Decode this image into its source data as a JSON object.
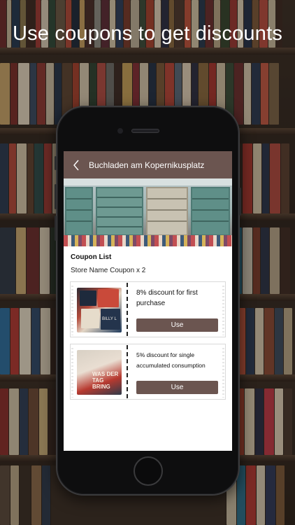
{
  "headline": "Use coupons to get discounts",
  "app": {
    "store_title": "Buchladen am Kopernikusplatz",
    "back_icon": "chevron-left-icon",
    "section_title": "Coupon List",
    "store_coupon_count": "Store Name Coupon x 2",
    "accent_color": "#6b5550",
    "coupons": [
      {
        "description": "8% discount for first purchase",
        "button_label": "Use",
        "image_text": "BILLY L"
      },
      {
        "description": "5% discount for single accumulated consumption",
        "button_label": "Use",
        "image_text": "WAS DER TAG BRING"
      }
    ]
  }
}
